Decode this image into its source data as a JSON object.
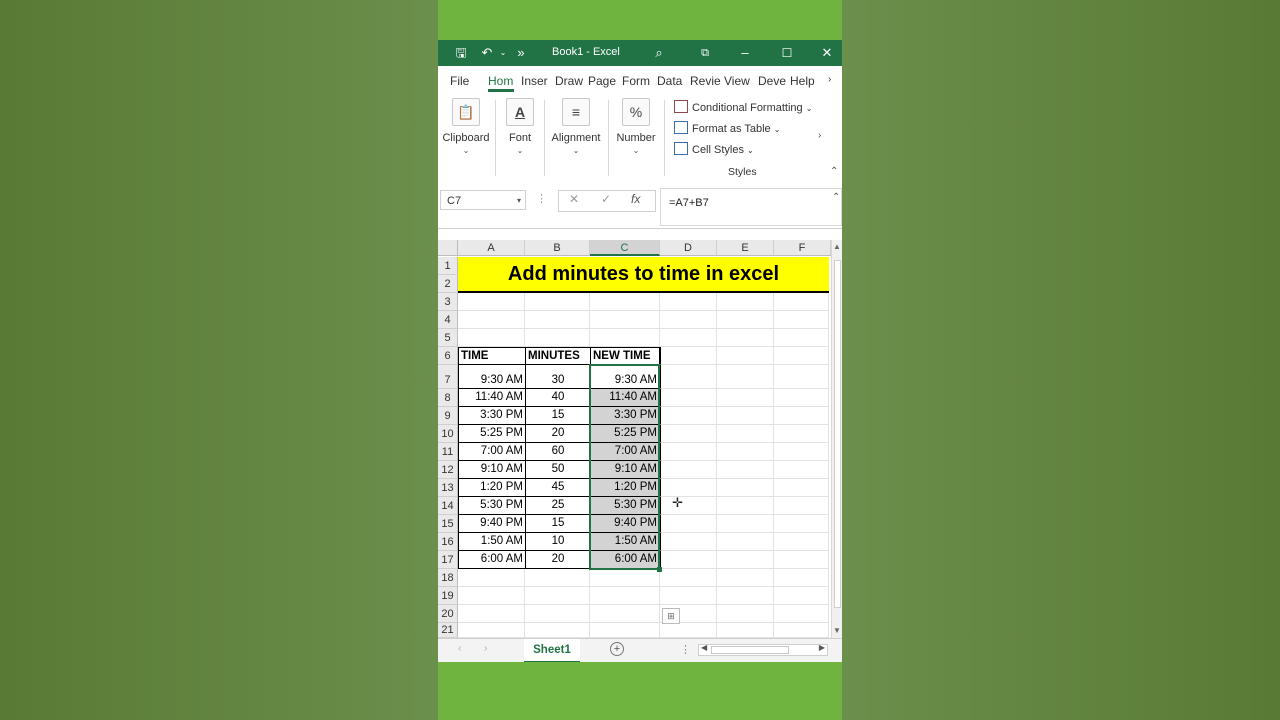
{
  "titlebar": {
    "title": "Book1  -  Excel"
  },
  "tabs": [
    "File",
    "Hom",
    "Inser",
    "Draw",
    "Page",
    "Form",
    "Data",
    "Revie",
    "View",
    "Deve",
    "Help"
  ],
  "ribbon": {
    "groups": [
      "Clipboard",
      "Font",
      "Alignment",
      "Number"
    ],
    "styles_items": [
      "Conditional Formatting",
      "Format as Table",
      "Cell Styles"
    ],
    "styles_label": "Styles"
  },
  "formula_bar": {
    "name_box": "C7",
    "fx": "fx",
    "formula": "=A7+B7"
  },
  "sheet": {
    "columns": [
      "A",
      "B",
      "C",
      "D",
      "E",
      "F"
    ],
    "rows": [
      "1",
      "2",
      "3",
      "4",
      "5",
      "6",
      "7",
      "8",
      "9",
      "10",
      "11",
      "12",
      "13",
      "14",
      "15",
      "16",
      "17",
      "18",
      "19",
      "20",
      "21"
    ],
    "title": "Add minutes to time in excel",
    "headers": [
      "TIME",
      "MINUTES",
      "NEW TIME"
    ],
    "data": [
      [
        "9:30 AM",
        "30",
        "9:30 AM"
      ],
      [
        "11:40 AM",
        "40",
        "11:40 AM"
      ],
      [
        "3:30 PM",
        "15",
        "3:30 PM"
      ],
      [
        "5:25 PM",
        "20",
        "5:25 PM"
      ],
      [
        "7:00 AM",
        "60",
        "7:00 AM"
      ],
      [
        "9:10 AM",
        "50",
        "9:10 AM"
      ],
      [
        "1:20 PM",
        "45",
        "1:20 PM"
      ],
      [
        "5:30 PM",
        "25",
        "5:30 PM"
      ],
      [
        "9:40 PM",
        "15",
        "9:40 PM"
      ],
      [
        "1:50 AM",
        "10",
        "1:50 AM"
      ],
      [
        "6:00 AM",
        "20",
        "6:00 AM"
      ]
    ]
  },
  "sheet_tabs": [
    "Sheet1"
  ],
  "colors": {
    "excel_green": "#217346",
    "title_fill": "#ffff00",
    "selection_gray": "#d3d3d3"
  }
}
